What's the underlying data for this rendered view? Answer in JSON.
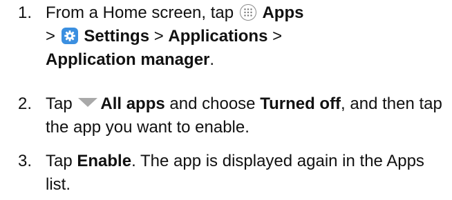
{
  "steps": [
    {
      "number": "1.",
      "parts": {
        "t1": "From a Home screen, tap",
        "apps": "Apps",
        "sep1": ">",
        "settings": "Settings",
        "sep2": ">",
        "applications": "Applications",
        "sep3": ">",
        "app_manager": "Application manager",
        "end": "."
      },
      "icons": [
        "apps-grid-icon",
        "settings-gear-icon"
      ]
    },
    {
      "number": "2.",
      "parts": {
        "t1": "Tap",
        "all_apps": "All apps",
        "t2": "and choose",
        "turned_off": "Turned off",
        "t3": ", and then tap the app you want to enable."
      },
      "icons": [
        "dropdown-triangle-icon"
      ]
    },
    {
      "number": "3.",
      "parts": {
        "t1": "Tap",
        "enable": "Enable",
        "t2": ". The app is displayed again in the Apps list."
      }
    }
  ],
  "colors": {
    "text": "#111111",
    "settings_icon_bg": "#3b8fe0",
    "apps_icon_border": "#8a8a8a",
    "triangle": "#a9a9a9"
  }
}
